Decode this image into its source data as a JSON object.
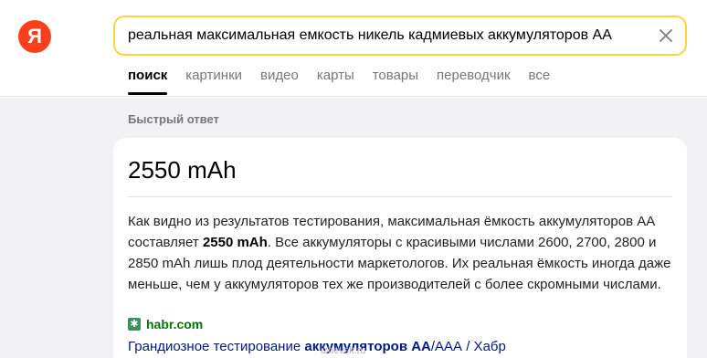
{
  "logo": {
    "glyph": "Я",
    "color": "#fc3f1d"
  },
  "search": {
    "query": "реальная максимальная емкость никель кадмиевых аккумуляторов АА",
    "clear_icon": "close-icon",
    "border_color": "#fcd33d"
  },
  "tabs": [
    {
      "label": "поиск",
      "active": true
    },
    {
      "label": "картинки",
      "active": false
    },
    {
      "label": "видео",
      "active": false
    },
    {
      "label": "карты",
      "active": false
    },
    {
      "label": "товары",
      "active": false
    },
    {
      "label": "переводчик",
      "active": false
    },
    {
      "label": "все",
      "active": false
    }
  ],
  "quick_answer": {
    "section_title": "Быстрый ответ",
    "answer": "2550 mAh",
    "snippet": {
      "part1": "Как видно из результатов тестирования, максимальная ёмкость аккумуляторов АА составляет ",
      "bold": "2550 mAh",
      "part2": ". Все аккумуляторы с красивыми числами 2600, 2700, 2800 и 2850 mAh лишь плод деятельности маркетологов. Их реальная ёмкость иногда даже меньше, чем у аккумуляторов тех же производителей с более скромными числами."
    },
    "source": {
      "domain": "habr.com",
      "favicon": "habr-icon",
      "link_part1": "Грандиозное тестирование ",
      "link_bold": "аккумуляторов АА",
      "link_part2": "/ААА / Хабр"
    }
  },
  "watermark": "izhevsk.ru"
}
